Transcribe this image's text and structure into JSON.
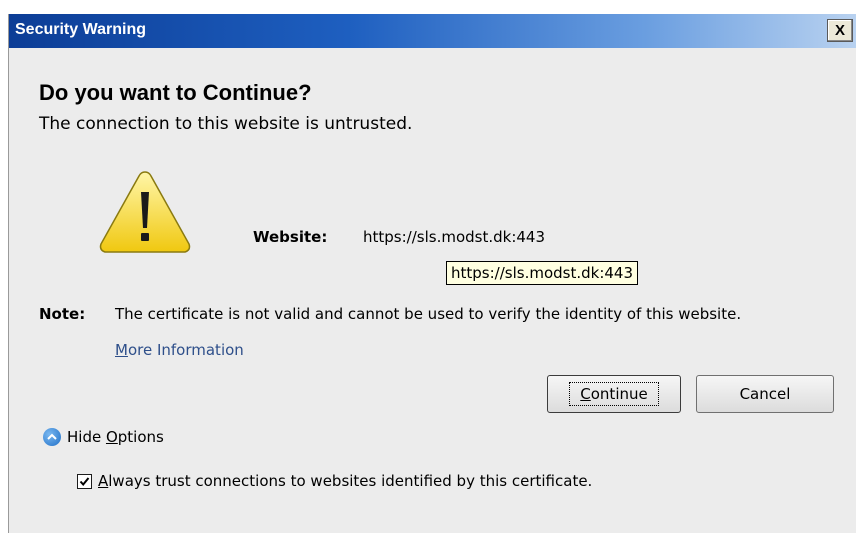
{
  "window": {
    "title": "Security Warning",
    "close_glyph": "X"
  },
  "main": {
    "heading": "Do you want to Continue?",
    "subheading": "The connection to this website is untrusted.",
    "website_label": "Website:",
    "website_url": "https://sls.modst.dk:443",
    "tooltip": "https://sls.modst.dk:443",
    "note_label": "Note:",
    "note_text": "The certificate is not valid and cannot be used to verify the identity of this website.",
    "more_info_first": "M",
    "more_info_rest": "ore Information"
  },
  "buttons": {
    "continue_first": "C",
    "continue_rest": "ontinue",
    "cancel": "Cancel"
  },
  "options": {
    "hide_prefix": "Hide ",
    "hide_first": "O",
    "hide_rest": "ptions",
    "trust_first": "A",
    "trust_rest": "lways trust connections to websites identified by this certificate.",
    "trust_checked": true
  },
  "icons": {
    "warning": "warning-triangle-icon",
    "close": "close-icon",
    "chevron": "chevron-up-icon",
    "checkmark": "checkmark-icon"
  },
  "colors": {
    "titlebar_start": "#0c3d96",
    "warning_yellow": "#f5d21a",
    "link": "#2e4f8a",
    "tooltip_bg": "#ffffe1"
  }
}
